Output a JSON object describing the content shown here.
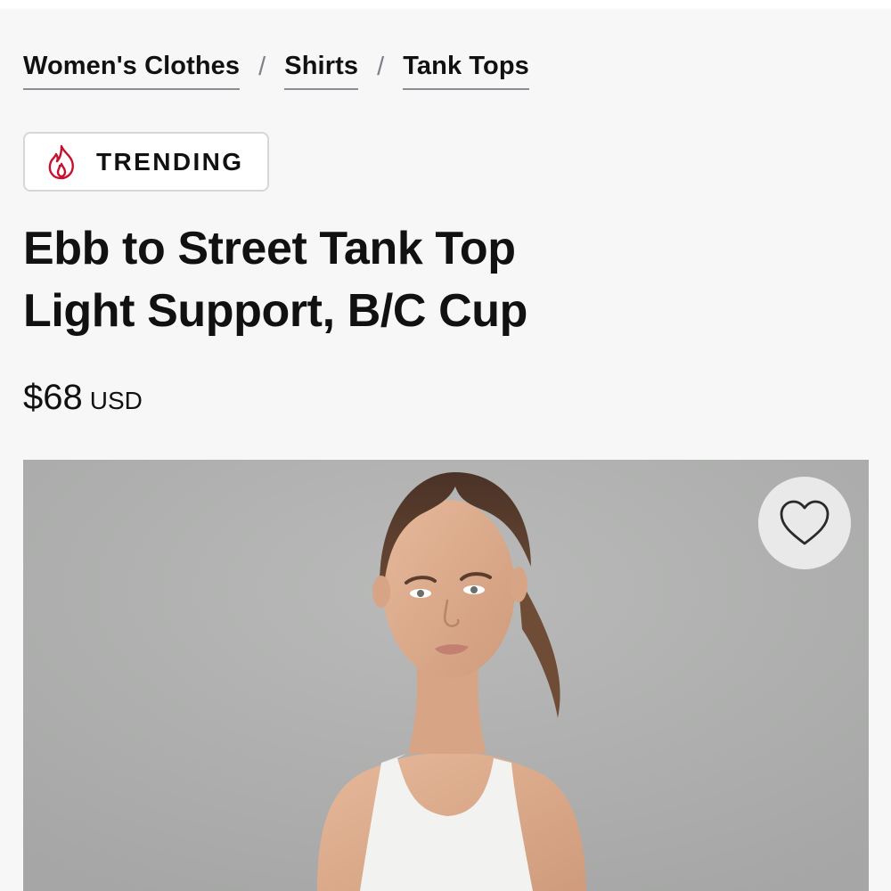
{
  "breadcrumb": {
    "items": [
      {
        "label": "Women's Clothes"
      },
      {
        "label": "Shirts"
      },
      {
        "label": "Tank Tops"
      }
    ],
    "separator": "/"
  },
  "badge": {
    "label": "TRENDING",
    "icon": "flame-icon",
    "icon_color": "#c8102e"
  },
  "product": {
    "title_line1": "Ebb to Street Tank Top",
    "title_line2": "Light Support, B/C Cup",
    "price": "$68",
    "currency": "USD"
  },
  "image": {
    "alt": "product-photo"
  },
  "wishlist": {
    "icon": "heart-icon"
  }
}
